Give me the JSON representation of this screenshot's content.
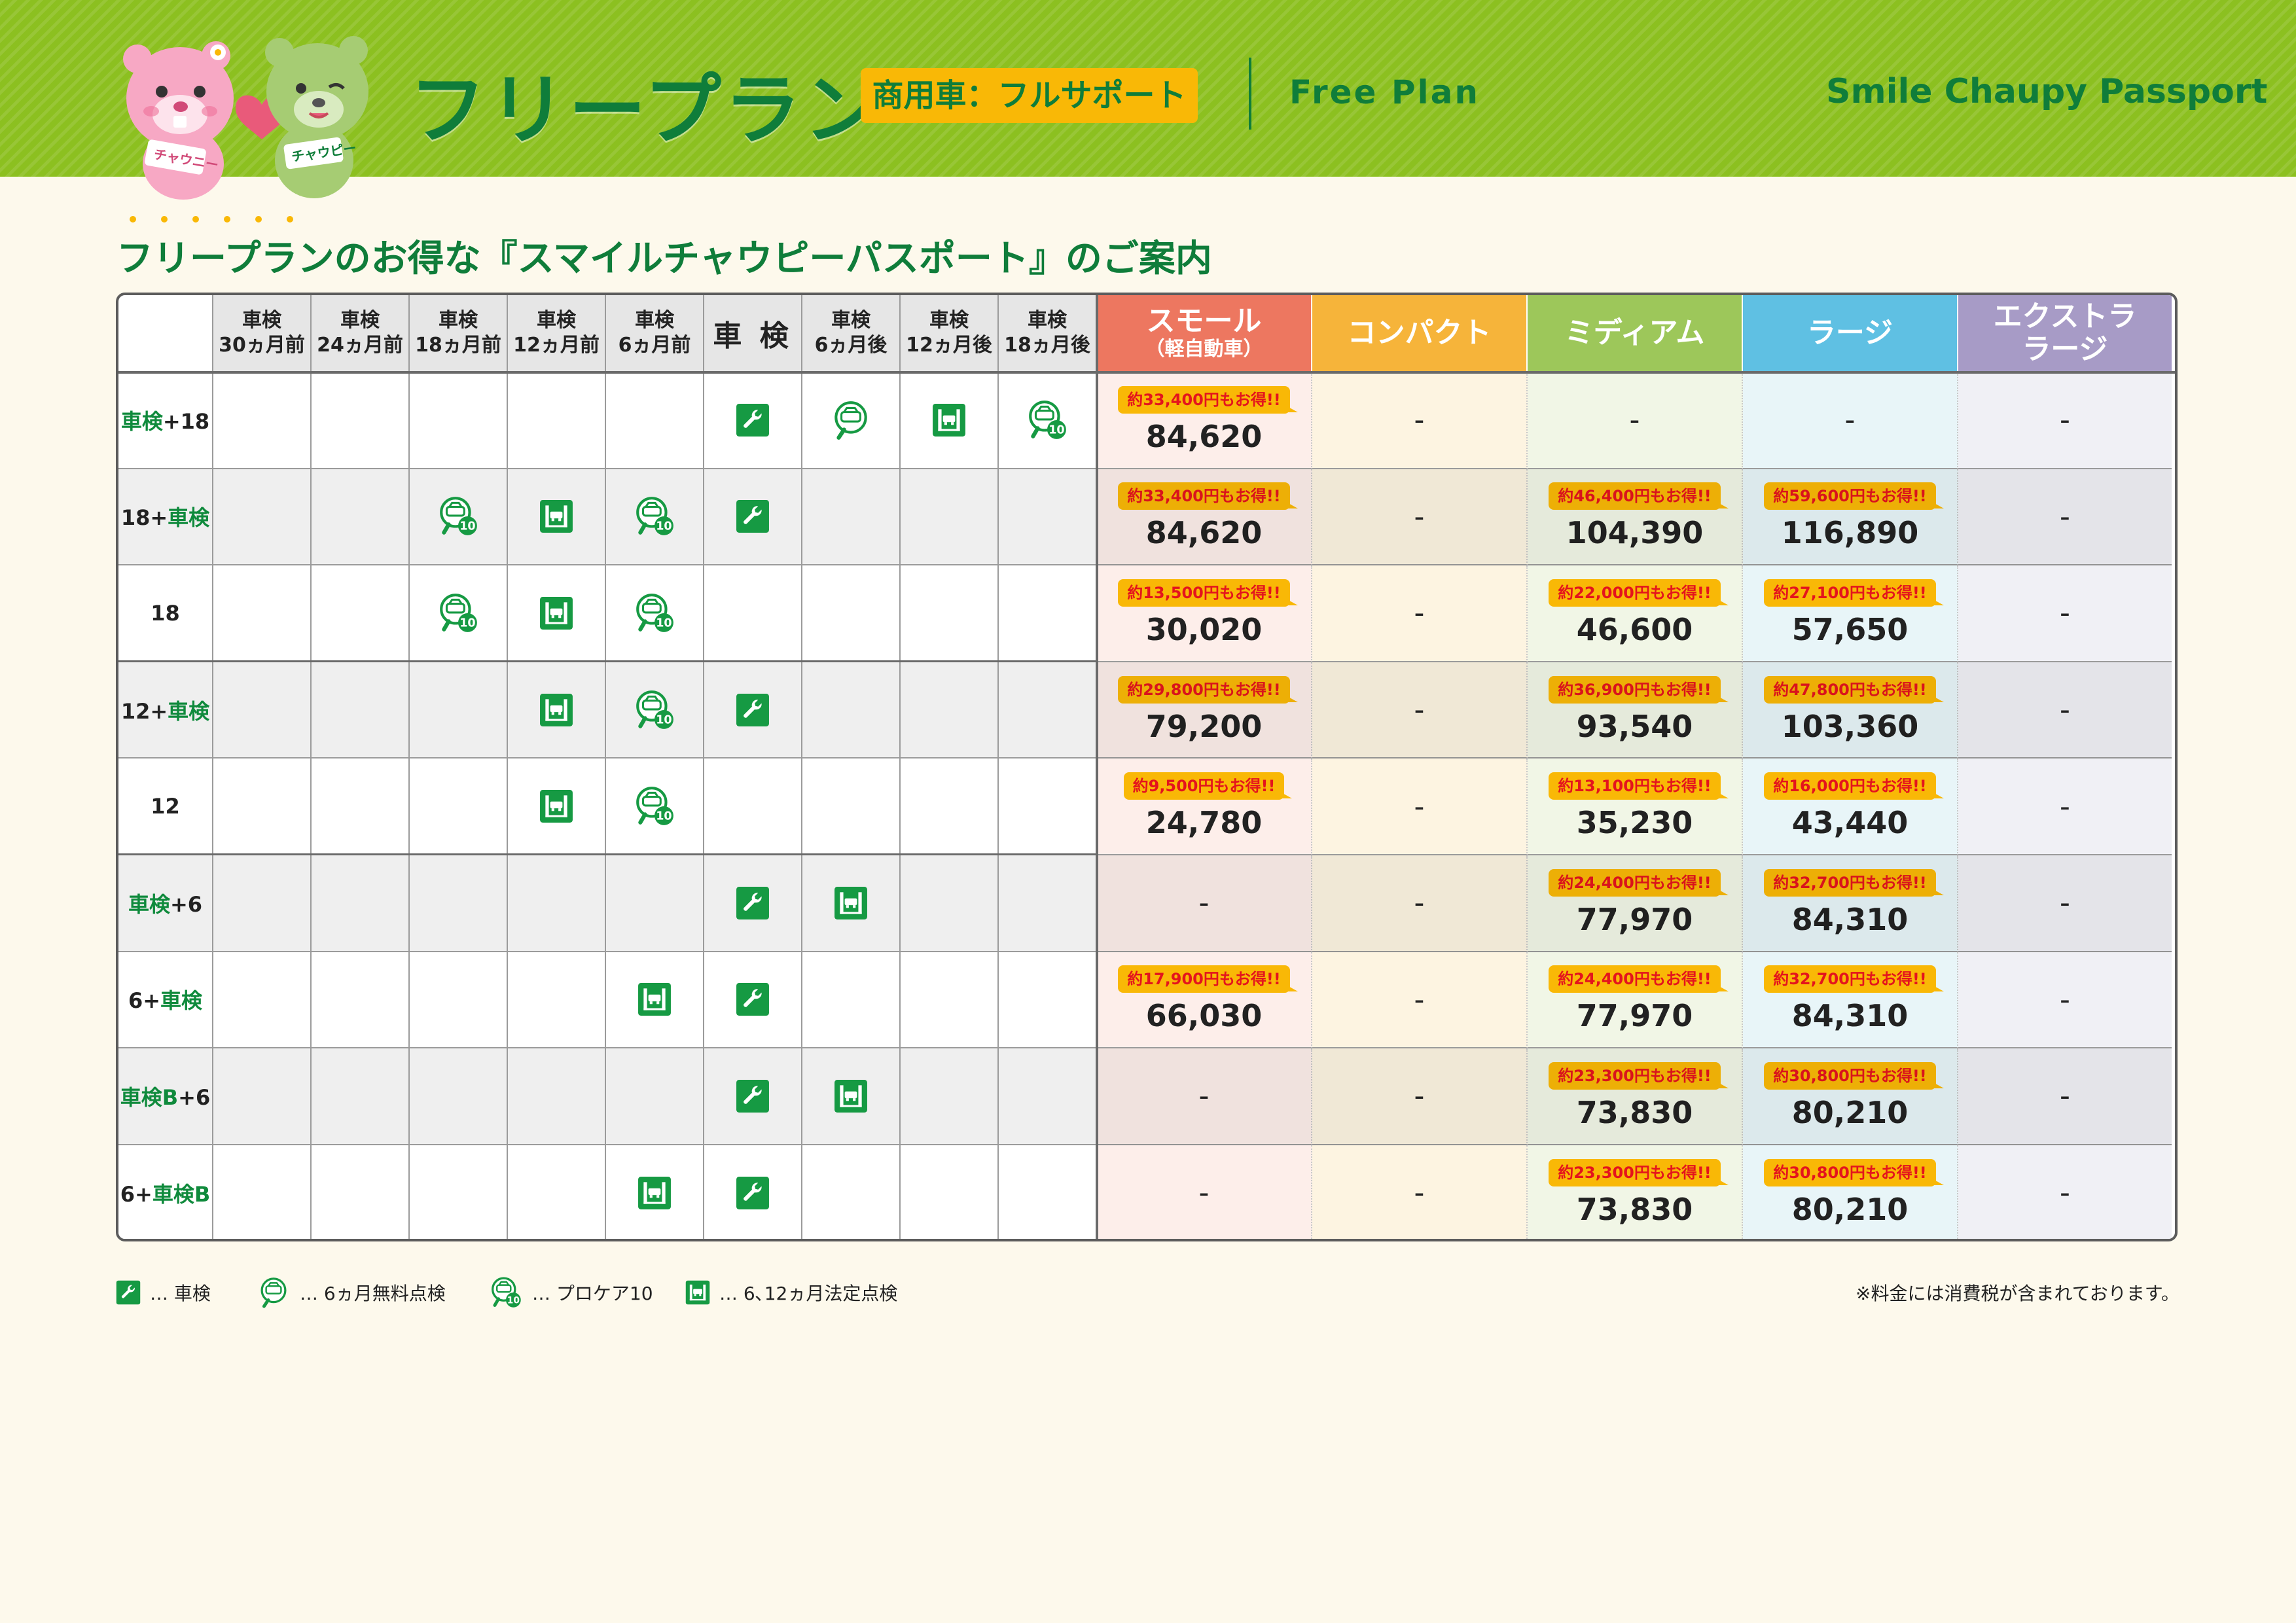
{
  "header": {
    "title": "フリープラン",
    "badge": "商用車：フルサポート",
    "title_en": "Free Plan",
    "brand": "Smile Chaupy Passport",
    "mascot_left_tag": "チャウニー",
    "mascot_right_tag": "チャウピー",
    "colors": {
      "band": "#8cc020",
      "accent": "#0f7d3a",
      "badge": "#f9b806"
    }
  },
  "subtitle": "フリープランのお得な『スマイルチャウピーパスポート』のご案内",
  "table": {
    "timeline_headers": [
      {
        "line1": "車検",
        "line2": "30ヵ月前"
      },
      {
        "line1": "車検",
        "line2": "24ヵ月前"
      },
      {
        "line1": "車検",
        "line2": "18ヵ月前"
      },
      {
        "line1": "車検",
        "line2": "12ヵ月前"
      },
      {
        "line1": "車検",
        "line2": "6ヵ月前"
      },
      {
        "line1": "車 検",
        "line2": ""
      },
      {
        "line1": "車検",
        "line2": "6ヵ月後"
      },
      {
        "line1": "車検",
        "line2": "12ヵ月後"
      },
      {
        "line1": "車検",
        "line2": "18ヵ月後"
      }
    ],
    "size_headers": [
      {
        "line1": "スモール",
        "line2": "（軽自動車）",
        "color": "#ed7760"
      },
      {
        "line1": "コンパクト",
        "line2": "",
        "color": "#f6b43a"
      },
      {
        "line1": "ミディアム",
        "line2": "",
        "color": "#9dc75a"
      },
      {
        "line1": "ラージ",
        "line2": "",
        "color": "#5fc0e3"
      },
      {
        "line1": "エクストラ",
        "line2": "ラージ",
        "color": "#a79bc6"
      }
    ],
    "column_tints": [
      "#fdeeea",
      "#fdf4e1",
      "#f1f6e6",
      "#e8f5f8",
      "#f0f0f5"
    ],
    "rows": [
      {
        "label": [
          {
            "t": "車検",
            "g": true
          },
          {
            "t": "+18",
            "g": false
          }
        ],
        "icons": [
          "",
          "",
          "",
          "",
          "",
          "wrench",
          "check6",
          "lift",
          "procare"
        ],
        "prices": [
          {
            "badge": "約33,400円もお得!!",
            "value": "84,620"
          },
          {
            "badge": "",
            "value": "-"
          },
          {
            "badge": "",
            "value": "-"
          },
          {
            "badge": "",
            "value": "-"
          },
          {
            "badge": "",
            "value": "-"
          }
        ]
      },
      {
        "label": [
          {
            "t": "18+",
            "g": false
          },
          {
            "t": "車検",
            "g": true
          }
        ],
        "icons": [
          "",
          "",
          "procare",
          "lift",
          "procare",
          "wrench",
          "",
          "",
          ""
        ],
        "prices": [
          {
            "badge": "約33,400円もお得!!",
            "value": "84,620"
          },
          {
            "badge": "",
            "value": "-"
          },
          {
            "badge": "約46,400円もお得!!",
            "value": "104,390"
          },
          {
            "badge": "約59,600円もお得!!",
            "value": "116,890"
          },
          {
            "badge": "",
            "value": "-"
          }
        ]
      },
      {
        "label": [
          {
            "t": "18",
            "g": false
          }
        ],
        "icons": [
          "",
          "",
          "procare",
          "lift",
          "procare",
          "",
          "",
          "",
          ""
        ],
        "prices": [
          {
            "badge": "約13,500円もお得!!",
            "value": "30,020"
          },
          {
            "badge": "",
            "value": "-"
          },
          {
            "badge": "約22,000円もお得!!",
            "value": "46,600"
          },
          {
            "badge": "約27,100円もお得!!",
            "value": "57,650"
          },
          {
            "badge": "",
            "value": "-"
          }
        ]
      },
      {
        "label": [
          {
            "t": "12+",
            "g": false
          },
          {
            "t": "車検",
            "g": true
          }
        ],
        "icons": [
          "",
          "",
          "",
          "lift",
          "procare",
          "wrench",
          "",
          "",
          ""
        ],
        "prices": [
          {
            "badge": "約29,800円もお得!!",
            "value": "79,200"
          },
          {
            "badge": "",
            "value": "-"
          },
          {
            "badge": "約36,900円もお得!!",
            "value": "93,540"
          },
          {
            "badge": "約47,800円もお得!!",
            "value": "103,360"
          },
          {
            "badge": "",
            "value": "-"
          }
        ]
      },
      {
        "label": [
          {
            "t": "12",
            "g": false
          }
        ],
        "icons": [
          "",
          "",
          "",
          "lift",
          "procare",
          "",
          "",
          "",
          ""
        ],
        "prices": [
          {
            "badge": "約9,500円もお得!!",
            "value": "24,780"
          },
          {
            "badge": "",
            "value": "-"
          },
          {
            "badge": "約13,100円もお得!!",
            "value": "35,230"
          },
          {
            "badge": "約16,000円もお得!!",
            "value": "43,440"
          },
          {
            "badge": "",
            "value": "-"
          }
        ]
      },
      {
        "label": [
          {
            "t": "車検",
            "g": true
          },
          {
            "t": "+6",
            "g": false
          }
        ],
        "icons": [
          "",
          "",
          "",
          "",
          "",
          "wrench",
          "lift",
          "",
          ""
        ],
        "prices": [
          {
            "badge": "",
            "value": "-"
          },
          {
            "badge": "",
            "value": "-"
          },
          {
            "badge": "約24,400円もお得!!",
            "value": "77,970"
          },
          {
            "badge": "約32,700円もお得!!",
            "value": "84,310"
          },
          {
            "badge": "",
            "value": "-"
          }
        ]
      },
      {
        "label": [
          {
            "t": "6+",
            "g": false
          },
          {
            "t": "車検",
            "g": true
          }
        ],
        "icons": [
          "",
          "",
          "",
          "",
          "lift",
          "wrench",
          "",
          "",
          ""
        ],
        "prices": [
          {
            "badge": "約17,900円もお得!!",
            "value": "66,030"
          },
          {
            "badge": "",
            "value": "-"
          },
          {
            "badge": "約24,400円もお得!!",
            "value": "77,970"
          },
          {
            "badge": "約32,700円もお得!!",
            "value": "84,310"
          },
          {
            "badge": "",
            "value": "-"
          }
        ]
      },
      {
        "label": [
          {
            "t": "車検B",
            "g": true
          },
          {
            "t": "+6",
            "g": false
          }
        ],
        "icons": [
          "",
          "",
          "",
          "",
          "",
          "wrench",
          "lift",
          "",
          ""
        ],
        "prices": [
          {
            "badge": "",
            "value": "-"
          },
          {
            "badge": "",
            "value": "-"
          },
          {
            "badge": "約23,300円もお得!!",
            "value": "73,830"
          },
          {
            "badge": "約30,800円もお得!!",
            "value": "80,210"
          },
          {
            "badge": "",
            "value": "-"
          }
        ]
      },
      {
        "label": [
          {
            "t": "6+",
            "g": false
          },
          {
            "t": "車検B",
            "g": true
          }
        ],
        "icons": [
          "",
          "",
          "",
          "",
          "lift",
          "wrench",
          "",
          "",
          ""
        ],
        "prices": [
          {
            "badge": "",
            "value": "-"
          },
          {
            "badge": "",
            "value": "-"
          },
          {
            "badge": "約23,300円もお得!!",
            "value": "73,830"
          },
          {
            "badge": "約30,800円もお得!!",
            "value": "80,210"
          },
          {
            "badge": "",
            "value": "-"
          }
        ]
      }
    ]
  },
  "legend": [
    {
      "icon": "wrench",
      "text": "… 車検"
    },
    {
      "icon": "check6",
      "text": "… 6ヵ月無料点検"
    },
    {
      "icon": "procare",
      "text": "… プロケア10"
    },
    {
      "icon": "lift",
      "text": "… 6､12ヵ月法定点検"
    }
  ],
  "note": "※料金には消費税が含まれております。"
}
